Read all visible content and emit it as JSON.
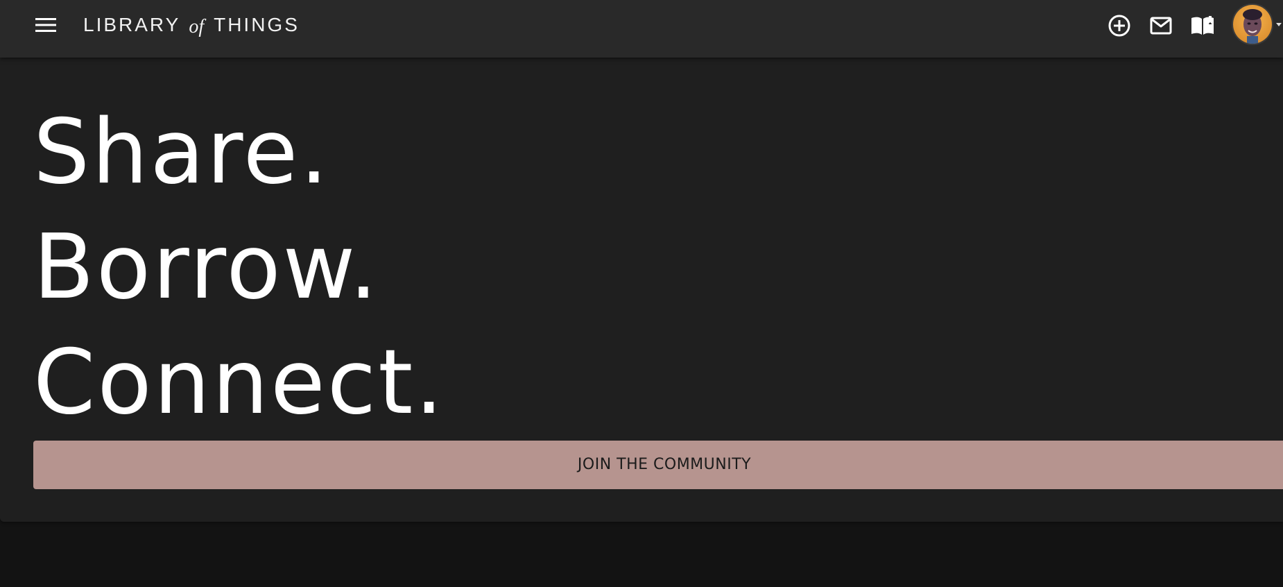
{
  "header": {
    "brand": {
      "word_left": "LIBRARY",
      "word_mid": "of",
      "word_right": "THINGS"
    },
    "icons": [
      "menu-icon",
      "add-circle-icon",
      "mail-icon",
      "book-icon",
      "avatar",
      "chevron-down-icon"
    ]
  },
  "hero": {
    "line1": "Share.",
    "line2": "Borrow.",
    "line3": "Connect.",
    "cta_label": "JOIN THE COMMUNITY"
  },
  "colors": {
    "topbar": "#292929",
    "hero_bg": "#1f1f1f",
    "page_bg": "#131313",
    "cta_bg": "#b6948f",
    "text": "#ffffff"
  }
}
